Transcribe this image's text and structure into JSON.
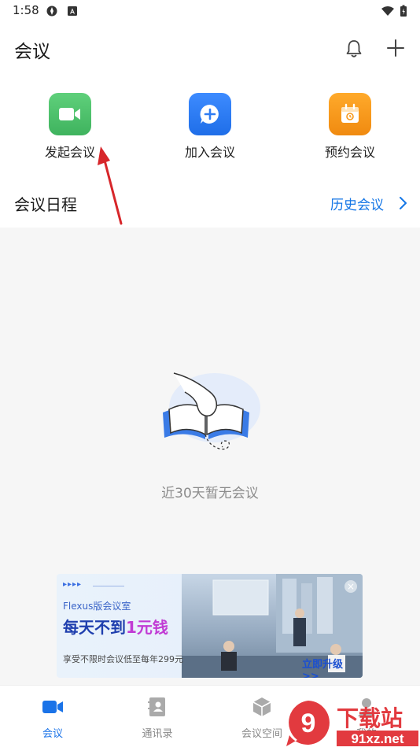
{
  "status_bar": {
    "time": "1:58"
  },
  "header": {
    "title": "会议"
  },
  "actions": [
    {
      "label": "发起会议",
      "color": "#4cc46a"
    },
    {
      "label": "加入会议",
      "color": "#2f7cf3"
    },
    {
      "label": "预约会议",
      "color": "#f79a1c"
    }
  ],
  "schedule": {
    "title": "会议日程",
    "history_label": "历史会议",
    "empty_text": "近30天暂无会议"
  },
  "ad": {
    "arrows": "▸▸▸▸",
    "subtitle": "Flexus版会议室",
    "headline_a": "每天不到",
    "headline_b": "1元钱",
    "note": "享受不限时会议低至每年299元",
    "cta": "立即升级 >>",
    "close": "×"
  },
  "bottom_nav": [
    {
      "label": "会议",
      "active": true
    },
    {
      "label": "通讯录",
      "active": false
    },
    {
      "label": "会议空间",
      "active": false
    },
    {
      "label": "我的",
      "active": false
    }
  ],
  "watermark": {
    "text_top": "下载站",
    "text_bottom": "91xz.net",
    "badge": "9"
  },
  "colors": {
    "accent": "#1476e6",
    "nav_active": "#1a73e8",
    "nav_inactive": "#888888",
    "annotation": "#d7262a"
  }
}
